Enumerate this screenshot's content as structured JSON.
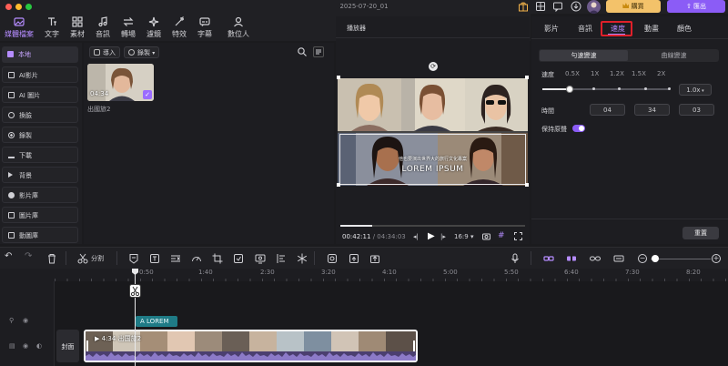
{
  "window": {
    "title": "2025-07-20_01"
  },
  "header_right": {
    "buy_label": "購買",
    "export_label": "匯出"
  },
  "toolbar": {
    "items": [
      {
        "label": "媒體檔案",
        "icon": "media-icon"
      },
      {
        "label": "文字",
        "icon": "text-icon"
      },
      {
        "label": "素材",
        "icon": "elements-icon"
      },
      {
        "label": "音訊",
        "icon": "music-icon"
      },
      {
        "label": "轉場",
        "icon": "transition-icon"
      },
      {
        "label": "濾鏡",
        "icon": "sparkle-icon"
      },
      {
        "label": "特效",
        "icon": "effects-icon"
      },
      {
        "label": "字幕",
        "icon": "captions-icon"
      },
      {
        "label": "數位人",
        "icon": "avatar-icon"
      }
    ]
  },
  "sidebar": {
    "items": [
      {
        "label": "本地"
      },
      {
        "label": "AI影片"
      },
      {
        "label": "AI 圖片"
      },
      {
        "label": "換臉"
      },
      {
        "label": "錄製"
      },
      {
        "label": "下載"
      },
      {
        "label": "背景"
      },
      {
        "label": "影片庫"
      },
      {
        "label": "圖片庫"
      },
      {
        "label": "動圖庫"
      }
    ]
  },
  "media": {
    "import_label": "導入",
    "record_label": "錄製",
    "clip": {
      "duration": "04:34",
      "name": "出國旅2"
    }
  },
  "preview": {
    "title": "播放器",
    "overlay_line1": "他也要演出世界大的旅行文化專案",
    "overlay_line2": "LOREM IPSUM",
    "current_time": "00:42:11",
    "total_time": "04:34:03",
    "aspect": "16:9",
    "progress": 0.17
  },
  "rpanel": {
    "tabs": [
      "影片",
      "音訊",
      "速度",
      "動畫",
      "顏色"
    ],
    "active_tab": "速度",
    "subtabs": [
      "勻速變速",
      "曲線變速"
    ],
    "speed_label": "速度",
    "speed_marks": [
      "0.5X",
      "1X",
      "1.2X",
      "1.5X",
      "2X"
    ],
    "speed_value": "1.0x",
    "time_label": "時間",
    "time_values": [
      "04",
      "34",
      "03"
    ],
    "keep_pitch_label": "保持原聲",
    "reset_label": "重置"
  },
  "timeline": {
    "split_label": "分割",
    "ruler": [
      "0:50",
      "1:40",
      "2:30",
      "3:20",
      "4:10",
      "5:00",
      "5:50",
      "6:40",
      "7:30",
      "8:20"
    ],
    "text_clip_label": "LOREM",
    "cover_label": "封面",
    "video_clip": {
      "duration": "4:34",
      "name": "出国旅2"
    }
  },
  "colors": {
    "accent": "#8b5cf6",
    "brand_orange": "#f2b24a",
    "highlight_red": "#e0202a"
  }
}
